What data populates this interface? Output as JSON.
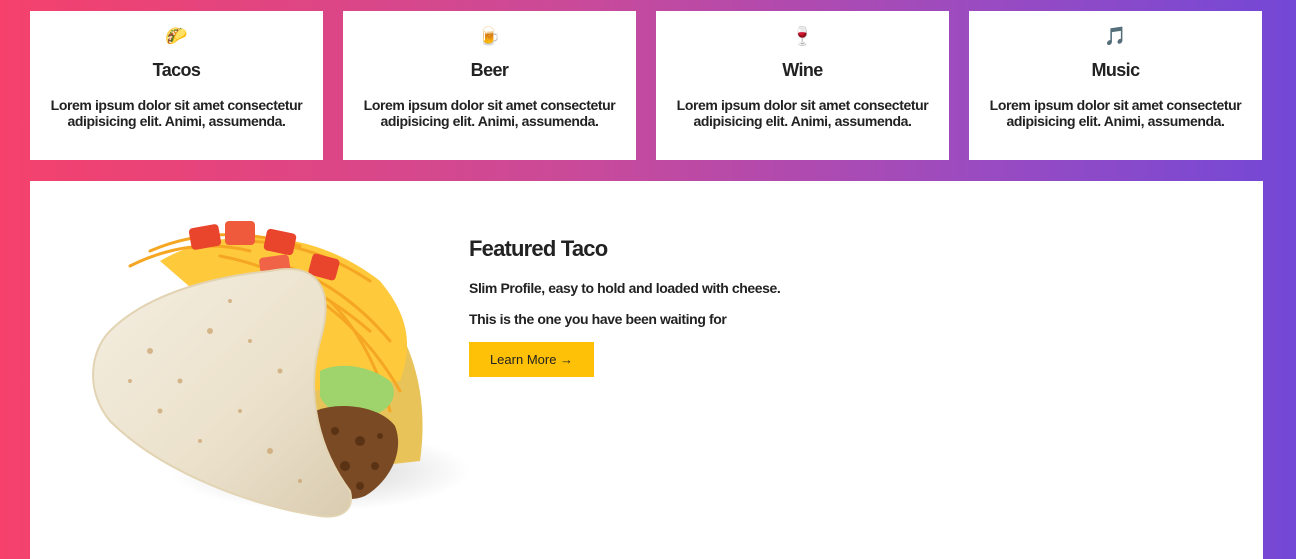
{
  "cards": [
    {
      "icon": "🌮",
      "icon_name": "taco-icon",
      "title": "Tacos",
      "text": "Lorem ipsum dolor sit amet consectetur adipisicing elit. Animi, assumenda."
    },
    {
      "icon": "🍺",
      "icon_name": "beer-icon",
      "title": "Beer",
      "text": "Lorem ipsum dolor sit amet consectetur adipisicing elit. Animi, assumenda."
    },
    {
      "icon": "🍷",
      "icon_name": "wine-icon",
      "title": "Wine",
      "text": "Lorem ipsum dolor sit amet consectetur adipisicing elit. Animi, assumenda."
    },
    {
      "icon": "🎵",
      "icon_name": "music-note-icon",
      "title": "Music",
      "text": "Lorem ipsum dolor sit amet consectetur adipisicing elit. Animi, assumenda."
    }
  ],
  "featured": {
    "title": "Featured Taco",
    "line1": "Slim Profile, easy to hold and loaded with cheese.",
    "line2": "This is the one you have been waiting for",
    "button_label": "Learn More →",
    "button_color": "#ffc107"
  }
}
